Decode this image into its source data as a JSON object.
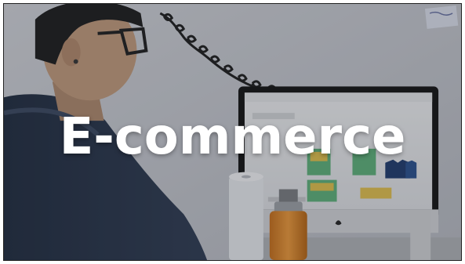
{
  "overlay": {
    "title": "E-commerce"
  },
  "colors": {
    "title_text": "#ffffff",
    "background_wall": "#c9ccd3",
    "monitor_frame": "#111111",
    "bottle": "#e0892a"
  },
  "scene": {
    "icons": [
      "person",
      "headset-cable",
      "computer-monitor",
      "paper-towel-roll",
      "water-bottle",
      "sticky-note"
    ]
  }
}
